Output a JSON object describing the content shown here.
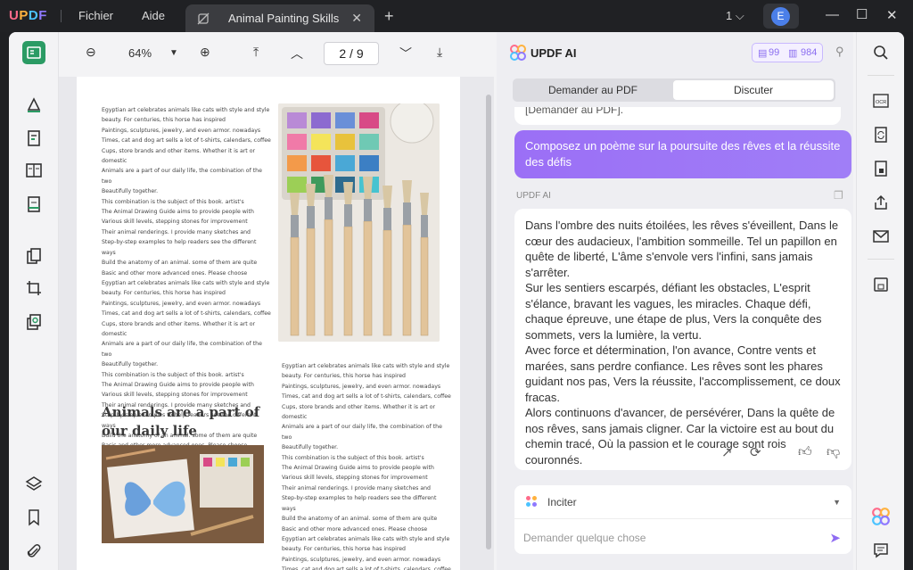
{
  "titlebar": {
    "menu": [
      "Fichier",
      "Aide"
    ],
    "tab_title": "Animal Painting Skills",
    "page_count": "1",
    "avatar_letter": "E"
  },
  "toolbar": {
    "zoom": "64%",
    "current_page": "2",
    "total_pages": "9",
    "page_sep": "/"
  },
  "pdf": {
    "paragraph": [
      "Egyptian art celebrates animals like cats with style and style",
      "beauty. For centuries, this horse has inspired",
      "Paintings, sculptures, jewelry, and even armor. nowadays",
      "Times, cat and dog art sells a lot of t-shirts, calendars, coffee",
      "Cups, store brands and other items. Whether it is art or domestic",
      "Animals are a part of our daily life, the combination of the two",
      "Beautifully together.",
      "This combination is the subject of this book. artist's",
      "The Animal Drawing Guide aims to provide people with",
      "Various skill levels, stepping stones for improvement",
      "Their animal renderings. I provide many sketches and",
      "Step-by-step examples to help readers see the different ways",
      "Build the anatomy of an animal. some of them are quite",
      "Basic and other more advanced ones. Please choose"
    ],
    "left_column": [
      "Egyptian art celebrates animals like cats with style and style",
      "beauty. For centuries, this horse has inspired",
      "Paintings, sculptures, jewelry, and even armor. nowadays",
      "Times, cat and dog art sells a lot of t-shirts, calendars, coffee",
      "Cups, store brands and other items. Whether it is art or domestic",
      "Animals are a part of our daily life, the combination of the two",
      "Beautifully together.",
      "This combination is the subject of this book. artist's",
      "The Animal Drawing Guide aims to provide people with",
      "Various skill levels, stepping stones for improvement",
      "Their animal renderings. I provide many sketches and",
      "Step-by-step examples to help readers see the different ways",
      "Build the anatomy of an animal. some of them are quite",
      "Basic and other more advanced ones. Please choose",
      "Egyptian art celebrates animals like cats with style and style",
      "beauty. For centuries, this horse has inspired",
      "Paintings, sculptures, jewelry, and even armor. nowadays",
      "Times, cat and dog art sells a lot of t-shirts, calendars, coffee",
      "Cups, store brands and other items. Whether it is art or domestic",
      "Animals are a part of our daily life, the combination of the two",
      "Beautifully together.",
      "This combination is the subject of this book. artist's",
      "The Animal Drawing Guide aims to provide people with",
      "Various skill levels, stepping stones for improvement",
      "Their animal renderings. I provide many sketches and",
      "Step-by-step examples to help readers see the different ways",
      "Build the anatomy of an animal. some of them are quite",
      "Basic and other more advanced ones. Please choose"
    ],
    "heading_line1": "Animals are a part of",
    "heading_line2": "our daily life",
    "right_column": [
      "Egyptian art celebrates animals like cats with style and style",
      "beauty. For centuries, this horse has inspired",
      "Paintings, sculptures, jewelry, and even armor. nowadays",
      "Times, cat and dog art sells a lot of t-shirts, calendars, coffee",
      "Cups, store brands and other items. Whether it is art or domestic",
      "Animals are a part of our daily life, the combination of the two",
      "Beautifully together.",
      "This combination is the subject of this book. artist's",
      "The Animal Drawing Guide aims to provide people with",
      "Various skill levels, stepping stones for improvement",
      "Their animal renderings. I provide many sketches and",
      "Step-by-step examples to help readers see the different ways",
      "Build the anatomy of an animal. some of them are quite",
      "Basic and other more advanced ones. Please choose",
      "Egyptian art celebrates animals like cats with style and style",
      "beauty. For centuries, this horse has inspired",
      "Paintings, sculptures, jewelry, and even armor. nowadays",
      "Times, cat and dog art sells a lot of t-shirts, calendars, coffee",
      "Cups, store brands and other items. Whether it is art or domestic"
    ]
  },
  "ai": {
    "title": "UPDF AI",
    "credits_a": "99",
    "credits_b": "984",
    "tab_pdf": "Demander au PDF",
    "tab_chat": "Discuter",
    "prev_text": "[Demander au PDF].",
    "user_message": "Composez un poème sur la poursuite des rêves et la réussite des défis",
    "ai_label": "UPDF AI",
    "answer": "Dans l'ombre des nuits étoilées, les rêves s'éveillent, Dans le cœur des audacieux, l'ambition sommeille. Tel un papillon en quête de liberté, L'âme s'envole vers l'infini, sans jamais s'arrêter.\nSur les sentiers escarpés, défiant les obstacles, L'esprit s'élance, bravant les vagues, les miracles. Chaque défi, chaque épreuve, une étape de plus, Vers la conquête des sommets, vers la lumière, la vertu.\nAvec force et détermination, l'on avance, Contre vents et marées, sans perdre confiance. Les rêves sont les phares guidant nos pas, Vers la réussite, l'accomplissement, ce doux fracas.\nAlors continuons d'avancer, de persévérer, Dans la quête de nos rêves, sans jamais cligner. Car la victoire est au bout du chemin tracé, Où la passion et le courage sont rois couronnés.",
    "prompt_label": "Inciter",
    "input_placeholder": "Demander quelque chose"
  },
  "colors": {
    "accent_green": "#2b9b64",
    "accent_purple": "#9b6ff6"
  }
}
